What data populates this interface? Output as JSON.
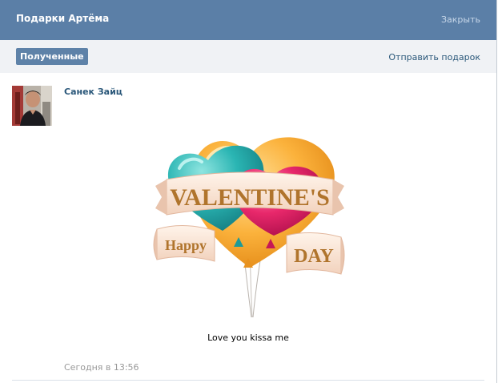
{
  "header": {
    "title": "Подарки Артёма",
    "close_label": "Закрыть"
  },
  "tabs": {
    "active_label": "Полученные",
    "send_gift_label": "Отправить подарок"
  },
  "gift": {
    "sender_name": "Санек Зайц",
    "image_text": {
      "line1": "VALENTINE'S",
      "line2a": "Happy",
      "line2b": "DAY"
    },
    "message": "Love you kissa me",
    "date": "Сегодня в 13:56"
  },
  "colors": {
    "header_bg": "#5b7fa7",
    "link": "#2b587a",
    "muted": "#999999"
  }
}
